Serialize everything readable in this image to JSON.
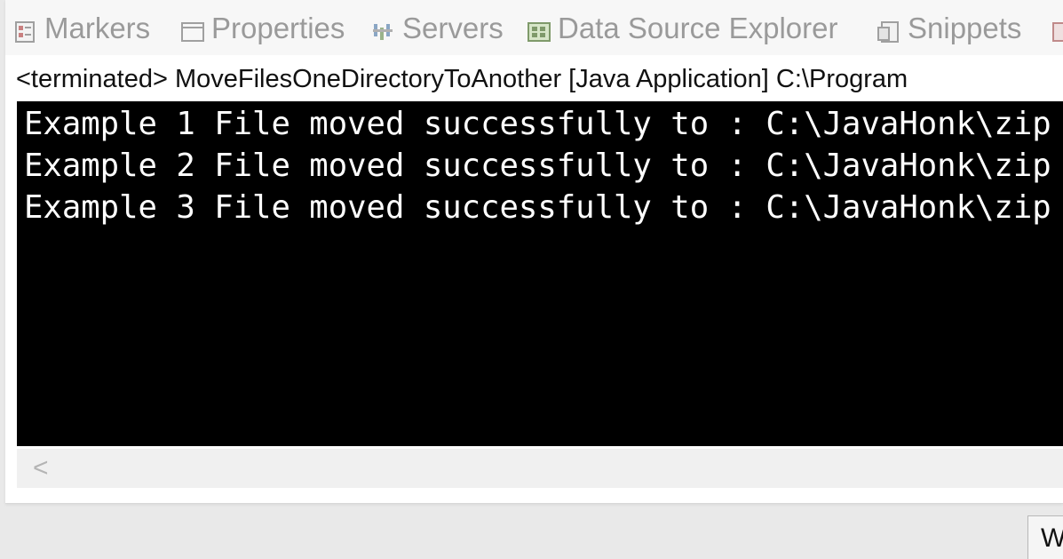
{
  "tabs": [
    {
      "label": "Markers",
      "icon": "markers-icon"
    },
    {
      "label": "Properties",
      "icon": "properties-icon"
    },
    {
      "label": "Servers",
      "icon": "servers-icon"
    },
    {
      "label": "Data Source Explorer",
      "icon": "data-source-explorer-icon"
    },
    {
      "label": "Snippets",
      "icon": "snippets-icon"
    }
  ],
  "console": {
    "title": "<terminated> MoveFilesOneDirectoryToAnother [Java Application] C:\\Program",
    "lines": [
      "Example 1 File moved successfully to : C:\\JavaHonk\\zip",
      "Example 2 File moved successfully to : C:\\JavaHonk\\zip",
      "Example 3 File moved successfully to : C:\\JavaHonk\\zip"
    ],
    "scroll_left_glyph": "<"
  },
  "status": {
    "partial_label": "W"
  }
}
